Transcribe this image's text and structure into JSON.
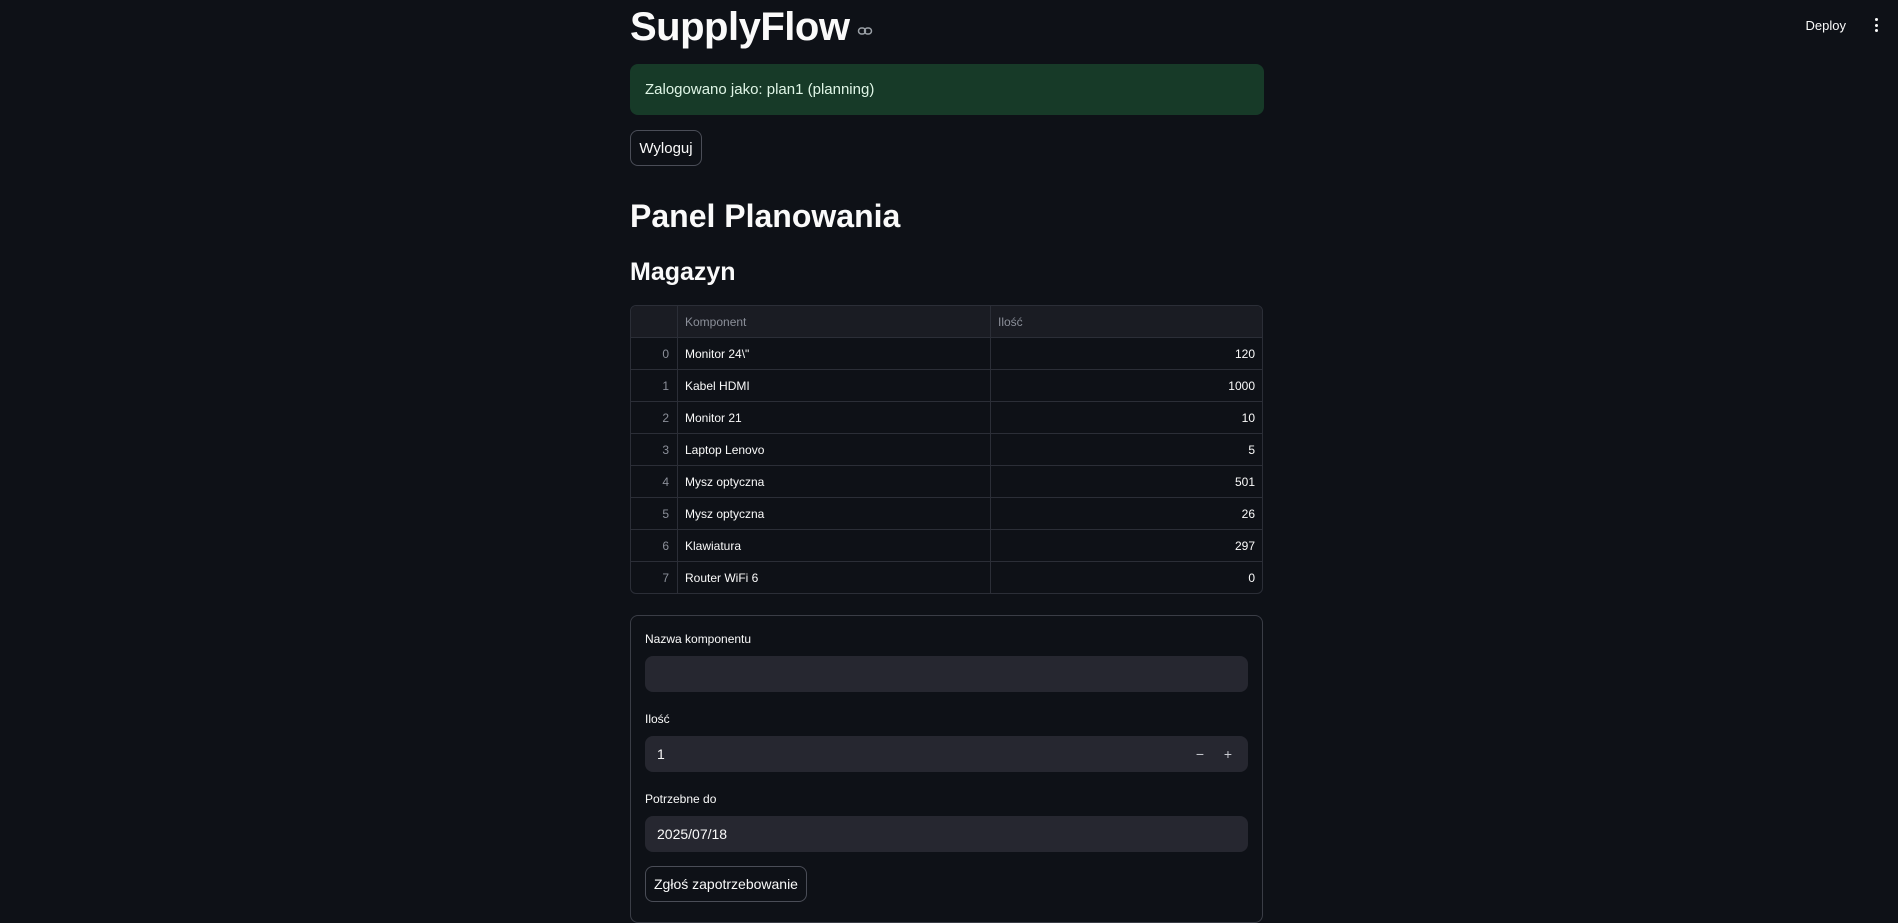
{
  "app": {
    "title": "SupplyFlow",
    "deploy_label": "Deploy"
  },
  "alert": {
    "text": "Zalogowano jako: plan1 (planning)"
  },
  "logout_label": "Wyloguj",
  "panel_title": "Panel Planowania",
  "section_title": "Magazyn",
  "table": {
    "columns": [
      "Komponent",
      "Ilość"
    ],
    "rows": [
      {
        "index": "0",
        "component": "Monitor 24\\\"",
        "qty": "120"
      },
      {
        "index": "1",
        "component": "Kabel HDMI",
        "qty": "1000"
      },
      {
        "index": "2",
        "component": "Monitor 21",
        "qty": "10"
      },
      {
        "index": "3",
        "component": "Laptop Lenovo",
        "qty": "5"
      },
      {
        "index": "4",
        "component": "Mysz optyczna",
        "qty": "501"
      },
      {
        "index": "5",
        "component": "Mysz optyczna",
        "qty": "26"
      },
      {
        "index": "6",
        "component": "Klawiatura",
        "qty": "297"
      },
      {
        "index": "7",
        "component": "Router WiFi 6",
        "qty": "0"
      }
    ]
  },
  "form": {
    "name_label": "Nazwa komponentu",
    "name_value": "",
    "qty_label": "Ilość",
    "qty_value": "1",
    "minus": "−",
    "plus": "+",
    "date_label": "Potrzebne do",
    "date_value": "2025/07/18",
    "submit_label": "Zgłoś zapotrzebowanie"
  },
  "colors": {
    "background": "#0e1117",
    "alert_bg": "#173a28",
    "input_bg": "#262730"
  }
}
